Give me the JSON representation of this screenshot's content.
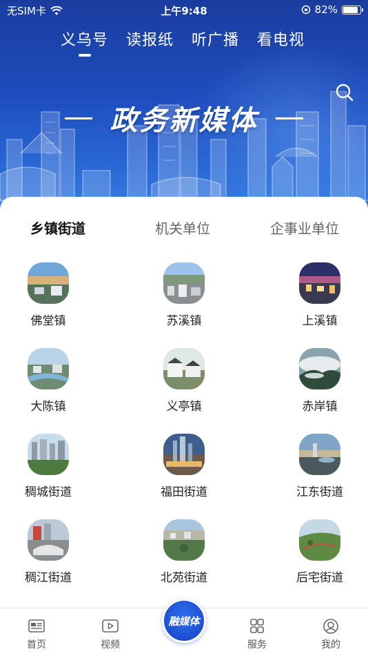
{
  "status_bar": {
    "carrier": "无SIM卡",
    "time": "上午9:48",
    "battery": "82%",
    "battery_level": 0.82
  },
  "top_tabs": [
    {
      "label": "义乌号",
      "active": true
    },
    {
      "label": "读报纸",
      "active": false
    },
    {
      "label": "听广播",
      "active": false
    },
    {
      "label": "看电视",
      "active": false
    }
  ],
  "banner": {
    "title": "政务新媒体"
  },
  "category_tabs": [
    {
      "label": "乡镇街道",
      "active": true
    },
    {
      "label": "机关单位",
      "active": false
    },
    {
      "label": "企事业单位",
      "active": false
    }
  ],
  "grid_items": [
    {
      "label": "佛堂镇"
    },
    {
      "label": "苏溪镇"
    },
    {
      "label": "上溪镇"
    },
    {
      "label": "大陈镇"
    },
    {
      "label": "义亭镇"
    },
    {
      "label": "赤岸镇"
    },
    {
      "label": "稠城街道"
    },
    {
      "label": "福田街道"
    },
    {
      "label": "江东街道"
    },
    {
      "label": "稠江街道"
    },
    {
      "label": "北苑街道"
    },
    {
      "label": "后宅街道"
    }
  ],
  "bottom_nav": {
    "home": "首页",
    "video": "视频",
    "center": "融媒体",
    "services": "服务",
    "mine": "我的"
  },
  "colors": {
    "brand_blue": "#1d4fcf",
    "hero_top": "#1a3c9e",
    "hero_bottom": "#3d86e6"
  }
}
